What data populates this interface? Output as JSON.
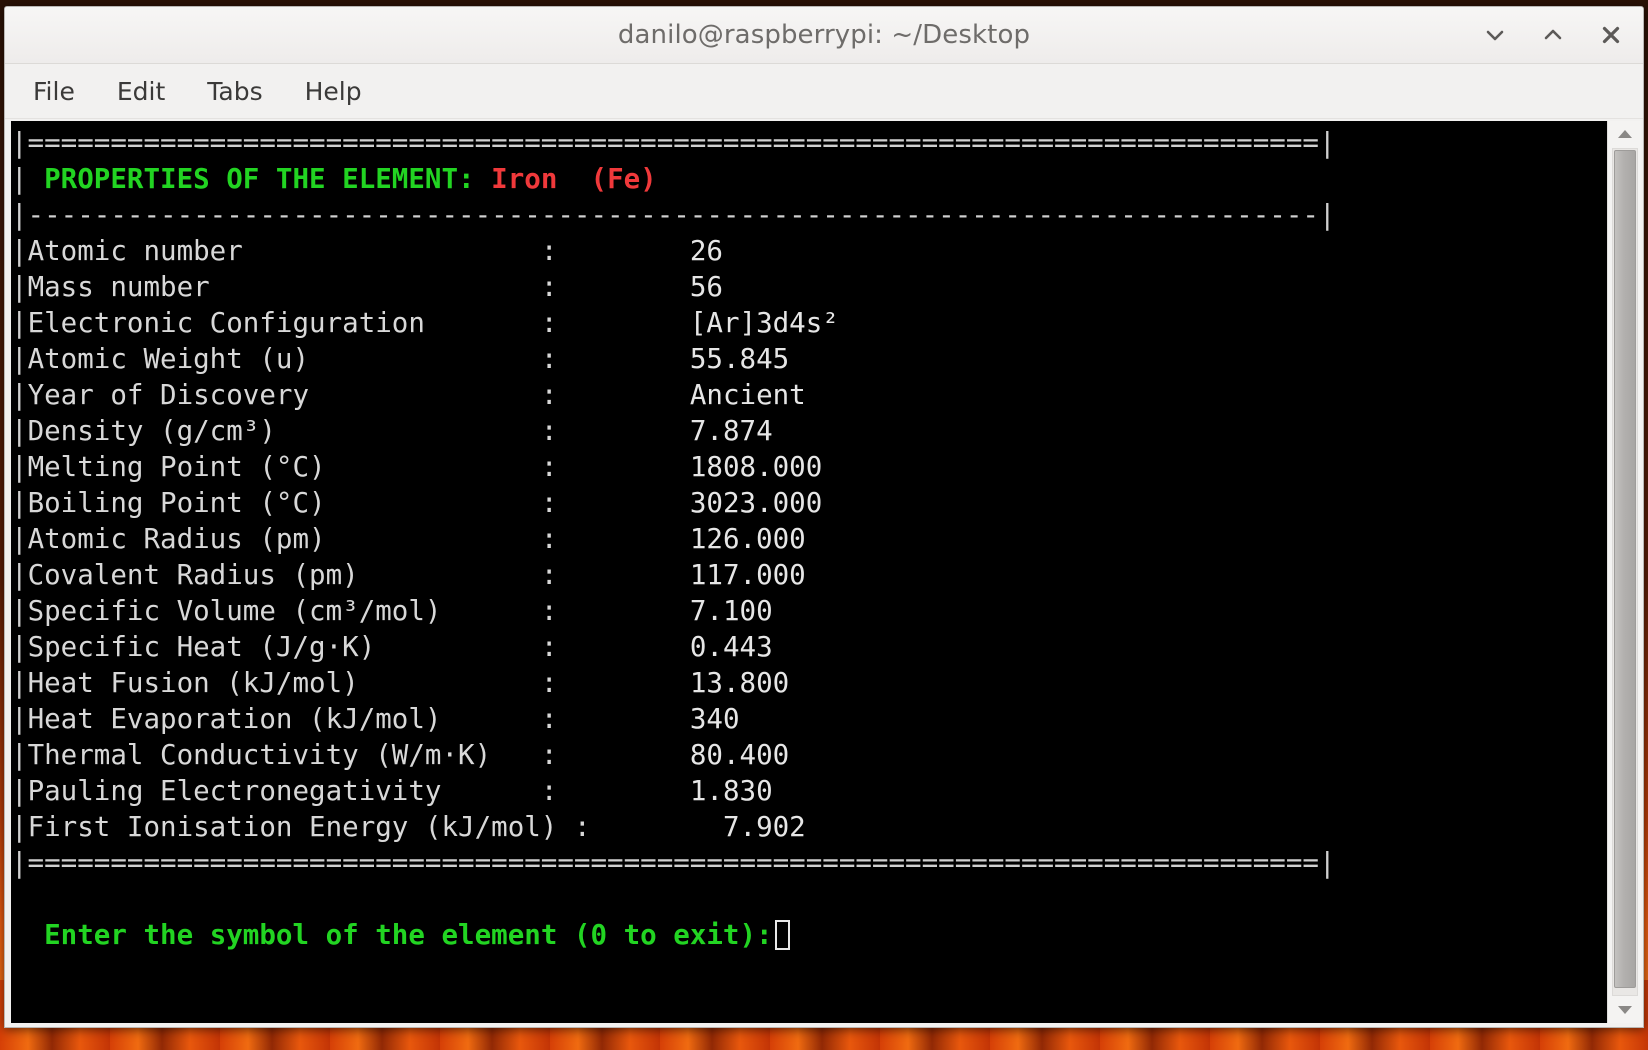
{
  "window": {
    "title": "danilo@raspberrypi: ~/Desktop",
    "controls": {
      "minimize": "minimize",
      "maximize": "maximize",
      "close": "close"
    }
  },
  "menubar": {
    "items": [
      {
        "label": "File"
      },
      {
        "label": "Edit"
      },
      {
        "label": "Tabs"
      },
      {
        "label": "Help"
      }
    ]
  },
  "terminal": {
    "border_top": "|==============================================================================|",
    "border_middle": "|------------------------------------------------------------------------------|",
    "border_bottom": "|==============================================================================|",
    "header": {
      "prefix": "| ",
      "label": "PROPERTIES OF THE ELEMENT:",
      "element_name": "Iron",
      "element_symbol": "(Fe)",
      "label_color": "#22d422",
      "element_color": "#f0393b"
    },
    "rows": [
      {
        "name": "Atomic number",
        "sep": ":",
        "value": "26"
      },
      {
        "name": "Mass number",
        "sep": ":",
        "value": "56"
      },
      {
        "name": "Electronic Configuration",
        "sep": ":",
        "value": "[Ar]3d4s²"
      },
      {
        "name": "Atomic Weight (u)",
        "sep": ":",
        "value": "55.845"
      },
      {
        "name": "Year of Discovery",
        "sep": ":",
        "value": "Ancient"
      },
      {
        "name": "Density (g/cm³)",
        "sep": ":",
        "value": "7.874"
      },
      {
        "name": "Melting Point (°C)",
        "sep": ":",
        "value": "1808.000"
      },
      {
        "name": "Boiling Point (°C)",
        "sep": ":",
        "value": "3023.000"
      },
      {
        "name": "Atomic Radius (pm)",
        "sep": ":",
        "value": "126.000"
      },
      {
        "name": "Covalent Radius (pm)",
        "sep": ":",
        "value": "117.000"
      },
      {
        "name": "Specific Volume (cm³/mol)",
        "sep": ":",
        "value": "7.100"
      },
      {
        "name": "Specific Heat (J/g·K)",
        "sep": ":",
        "value": "0.443"
      },
      {
        "name": "Heat Fusion (kJ/mol)",
        "sep": ":",
        "value": "13.800"
      },
      {
        "name": "Heat Evaporation (kJ/mol)",
        "sep": ":",
        "value": "340"
      },
      {
        "name": "Thermal Conductivity (W/m·K)",
        "sep": ":",
        "value": "80.400"
      },
      {
        "name": "Pauling Electronegativity",
        "sep": ":",
        "value": "1.830"
      },
      {
        "name": "First Ionisation Energy (kJ/mol)",
        "sep": ":",
        "value": "7.902"
      }
    ],
    "prompt": {
      "text": "Enter the symbol of the element (0 to exit):",
      "input_value": "",
      "color": "#22d422"
    },
    "background_color": "#000000",
    "foreground_color": "#d8d8d8"
  },
  "scrollbar": {
    "up_arrow": "scroll-up",
    "down_arrow": "scroll-down",
    "thumb_position_percent": 0
  }
}
